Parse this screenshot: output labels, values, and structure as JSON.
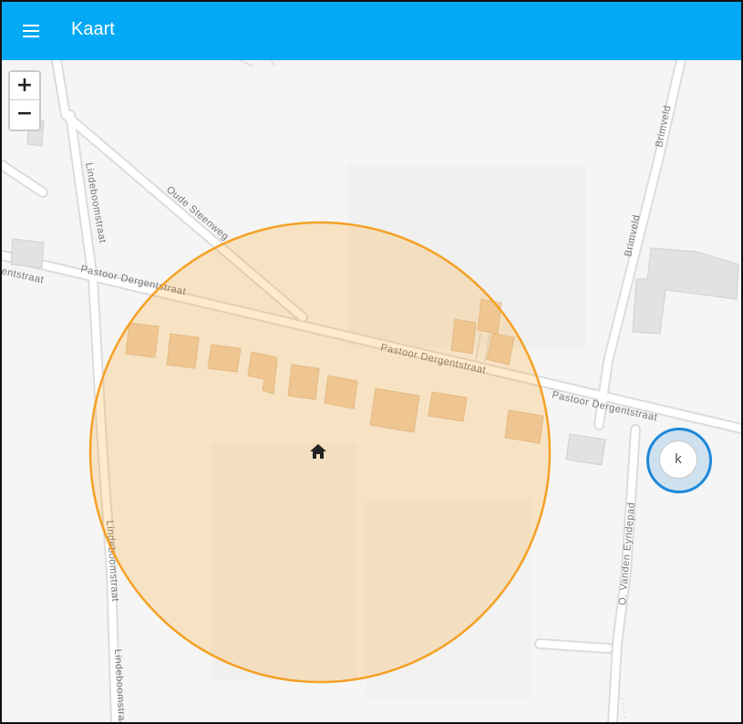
{
  "app_bar": {
    "title": "Kaart",
    "menu_icon": "menu-icon",
    "background_color": "#03a9f4"
  },
  "zoom": {
    "in_label": "+",
    "out_label": "−"
  },
  "streets": {
    "pastoor_1": "Pastoor Dergentstraat",
    "pastoor_left": "Pastoor Dergentstraat",
    "pastoor_2": "Pastoor Dergentstraat",
    "pastoor_3": "Pastoor Dergentstraat",
    "oude_steenweg": "Oude Steenweg",
    "lindeboom_1": "Lindeboomstraat",
    "lindeboom_2": "Lindeboomstraat",
    "lindeboom_3": "Lindeboomstraat",
    "brimveld_1": "Brimveld",
    "brimveld_2": "Brimveld",
    "vanden_eyndepad": "O. Vanden Eyndepad"
  },
  "markers": {
    "home_icon": "home-icon",
    "person_initial": "k",
    "zone_color": "#ff9800",
    "person_color": "#1e88d8"
  }
}
